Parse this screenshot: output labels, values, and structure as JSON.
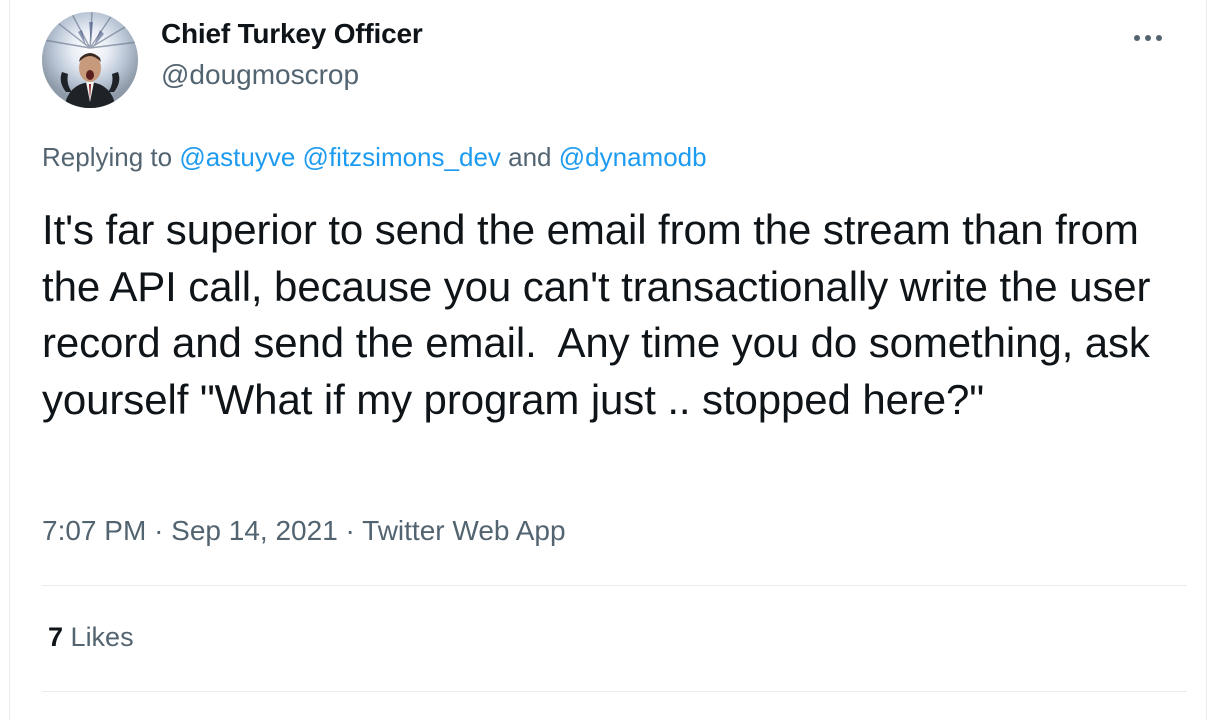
{
  "tweet": {
    "author": {
      "display_name": "Chief Turkey Officer",
      "handle": "@dougmoscrop",
      "avatar_icon": "profile-photo"
    },
    "menu_icon": "more-options-icon",
    "replying_to": {
      "prefix": "Replying to",
      "mentions": [
        "@astuyve",
        "@fitzsimons_dev",
        "@dynamodb"
      ],
      "conjunction": "and"
    },
    "text": "It's far superior to send the email from the stream than from the API call, because you can't transactionally write the user record and send the email.  Any time you do something, ask yourself \"What if my program just .. stopped here?\"",
    "time": "7:07 PM",
    "date": "Sep 14, 2021",
    "separator": "·",
    "source": "Twitter Web App",
    "likes": {
      "count": "7",
      "label": "Likes"
    }
  },
  "colors": {
    "text": "#0f1419",
    "secondary": "#536471",
    "link": "#1d9bf0",
    "divider": "#e6ecf0"
  }
}
